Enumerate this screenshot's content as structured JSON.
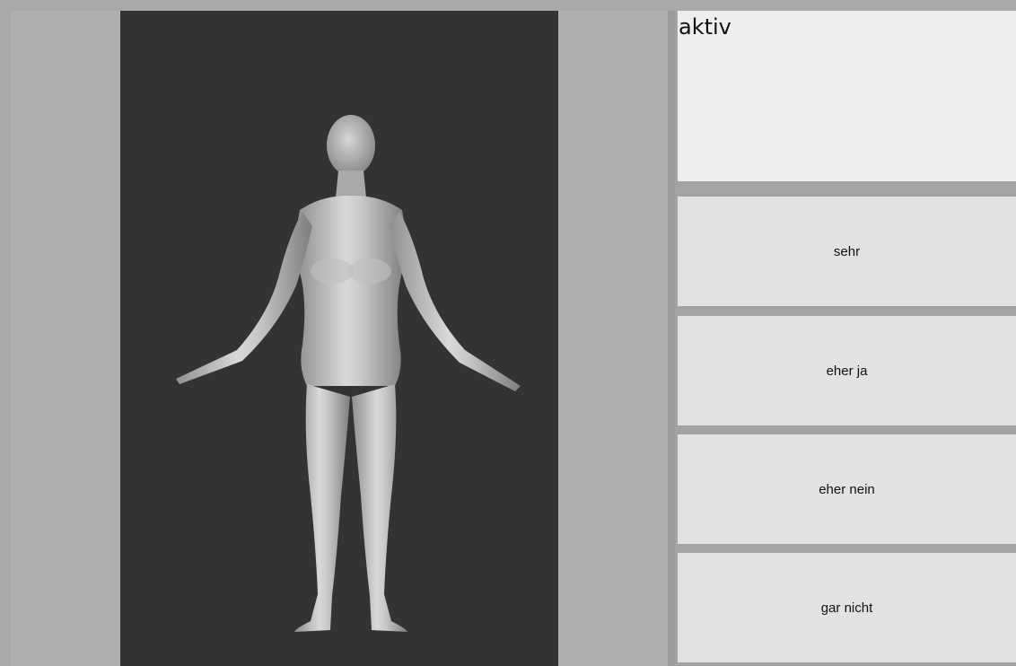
{
  "display": {
    "text": "aktiv"
  },
  "options": [
    {
      "label": "sehr"
    },
    {
      "label": "eher ja"
    },
    {
      "label": "eher nein"
    },
    {
      "label": "gar nicht"
    }
  ],
  "colors": {
    "viewport_bg": "#333333",
    "side_bg": "#b0b0b0",
    "button_bg": "#e2e2e2",
    "text_area_bg": "#eeeeee"
  }
}
